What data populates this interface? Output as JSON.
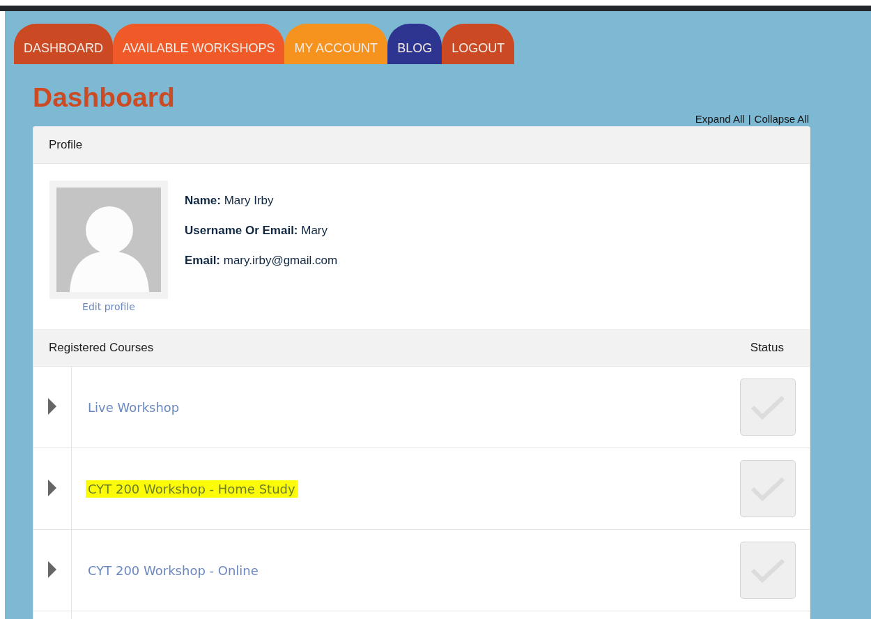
{
  "tabs": [
    {
      "label": "DASHBOARD",
      "color": "#cb4a24"
    },
    {
      "label": "AVAILABLE WORKSHOPS",
      "color": "#f05a28"
    },
    {
      "label": "MY ACCOUNT",
      "color": "#f6921e"
    },
    {
      "label": "BLOG",
      "color": "#2e3590"
    },
    {
      "label": "LOGOUT",
      "color": "#cb4a24"
    }
  ],
  "page_title": "Dashboard",
  "panel_links": [
    "Expand All",
    "Collapse All"
  ],
  "link_separator": "|",
  "profile": {
    "heading": "Profile",
    "edit_link": "Edit profile",
    "fields": [
      {
        "label": "Name:",
        "value": "Mary Irby"
      },
      {
        "label": "Username Or Email:",
        "value": "Mary"
      },
      {
        "label": "Email:",
        "value": "mary.irby@gmail.com"
      }
    ]
  },
  "courses": {
    "heading": "Registered Courses",
    "status_heading": "Status",
    "rows": [
      {
        "title": "Live Workshop",
        "expanded": false,
        "highlighted": false,
        "checked": false
      },
      {
        "title": "CYT 200 Workshop - Home Study",
        "expanded": false,
        "highlighted": true,
        "checked": false
      },
      {
        "title": "CYT 200 Workshop - Online",
        "expanded": false,
        "highlighted": false,
        "checked": false
      }
    ]
  }
}
